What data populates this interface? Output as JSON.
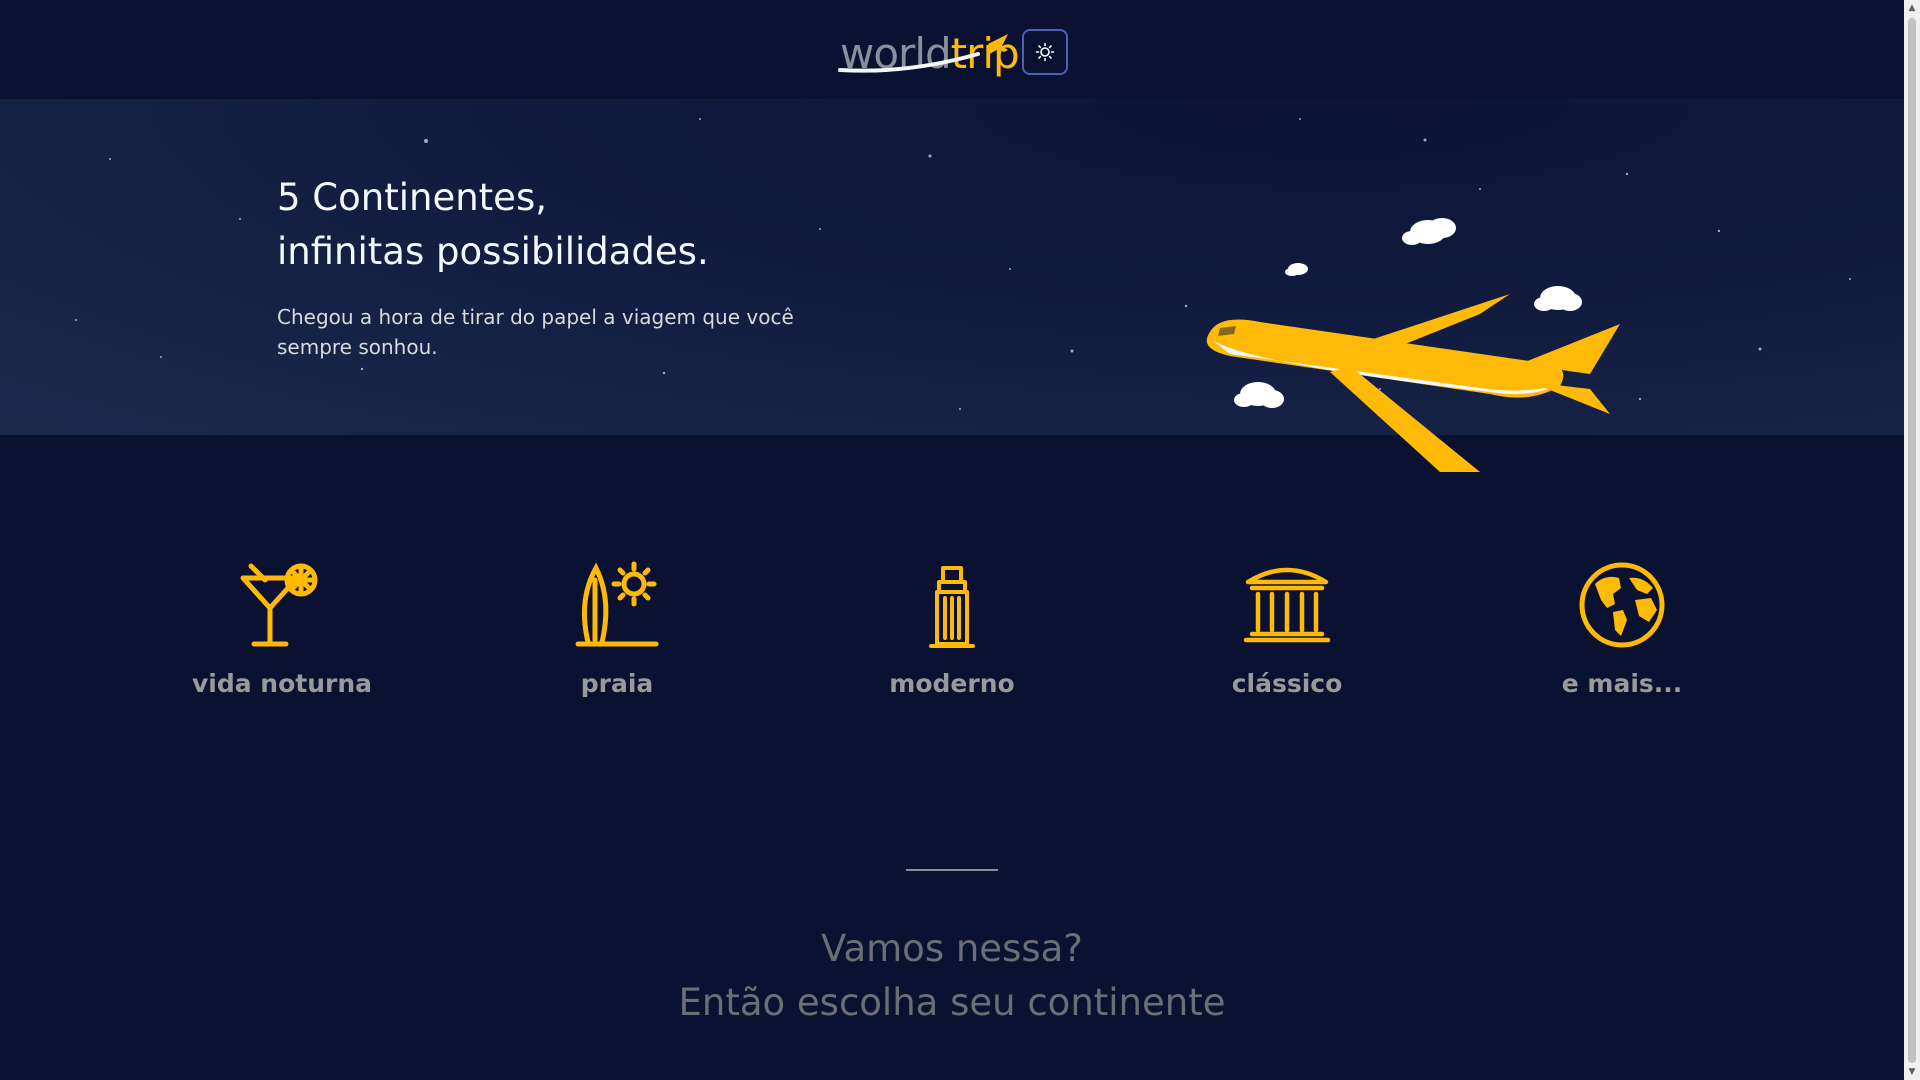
{
  "header": {
    "logo_world": "world",
    "logo_trip": "trip",
    "theme_toggle_icon": "sun-icon"
  },
  "hero": {
    "title_line1": "5 Continentes,",
    "title_line2": "infinitas possibilidades.",
    "subtitle": "Chegou a hora de tirar do papel a viagem que você sempre sonhou."
  },
  "travel_types": [
    {
      "label": "vida noturna",
      "icon": "cocktail-icon"
    },
    {
      "label": "praia",
      "icon": "surfboard-sun-icon"
    },
    {
      "label": "moderno",
      "icon": "skyscraper-icon"
    },
    {
      "label": "clássico",
      "icon": "museum-icon"
    },
    {
      "label": "e mais...",
      "icon": "globe-icon"
    }
  ],
  "cta": {
    "line1": "Vamos nessa?",
    "line2": "Então escolha seu continente"
  },
  "colors": {
    "background": "#0b1130",
    "accent": "#ffba08",
    "light_text": "#f5f8fa",
    "muted_text": "#9a9a9a"
  }
}
